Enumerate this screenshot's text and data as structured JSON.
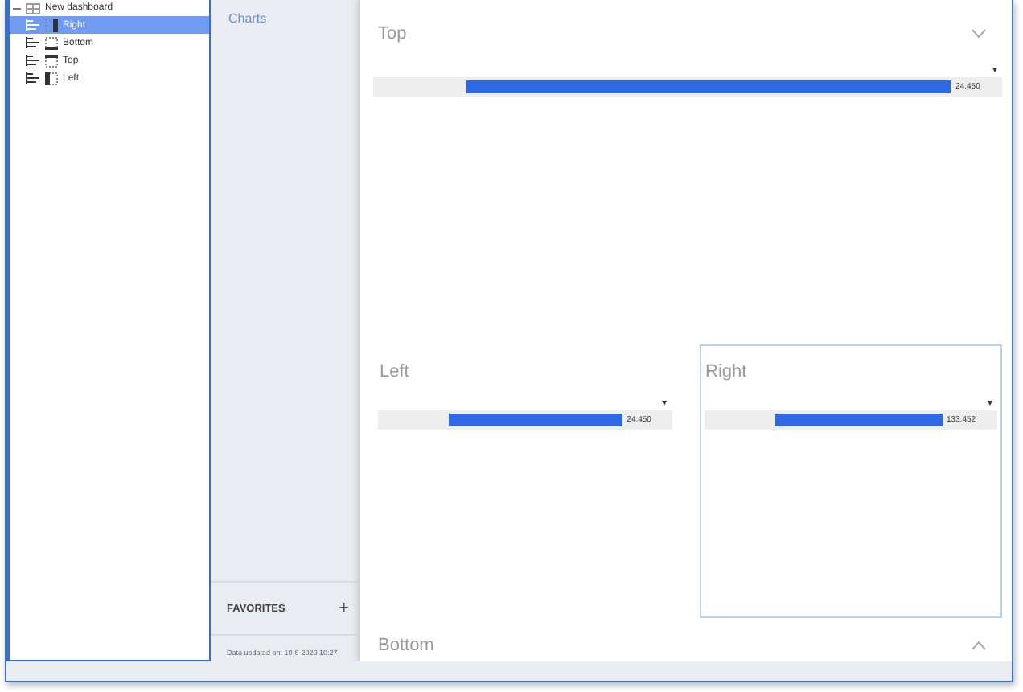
{
  "tree": {
    "label": "New dashboard",
    "expanded": true,
    "children": [
      {
        "label": "Right",
        "selected": true
      },
      {
        "label": "Bottom",
        "selected": false
      },
      {
        "label": "Top",
        "selected": false
      },
      {
        "label": "Left",
        "selected": false
      }
    ]
  },
  "sidebar": {
    "link": "Charts",
    "favorites": "FAVORITES",
    "plus": "+",
    "updated": "Data updated on: 10-6-2020 10:27"
  },
  "panels": [
    {
      "title": "Top",
      "expanded": true,
      "marker": "▾",
      "bar": {
        "value": "24.450"
      }
    },
    {
      "title": "Left",
      "selected": false,
      "marker": "▾",
      "bar": {
        "value": "24.450"
      }
    },
    {
      "title": "Right",
      "selected": true,
      "marker": "▾",
      "bar": {
        "value": "133.452"
      }
    },
    {
      "title": "Bottom",
      "expanded": false
    }
  ]
}
